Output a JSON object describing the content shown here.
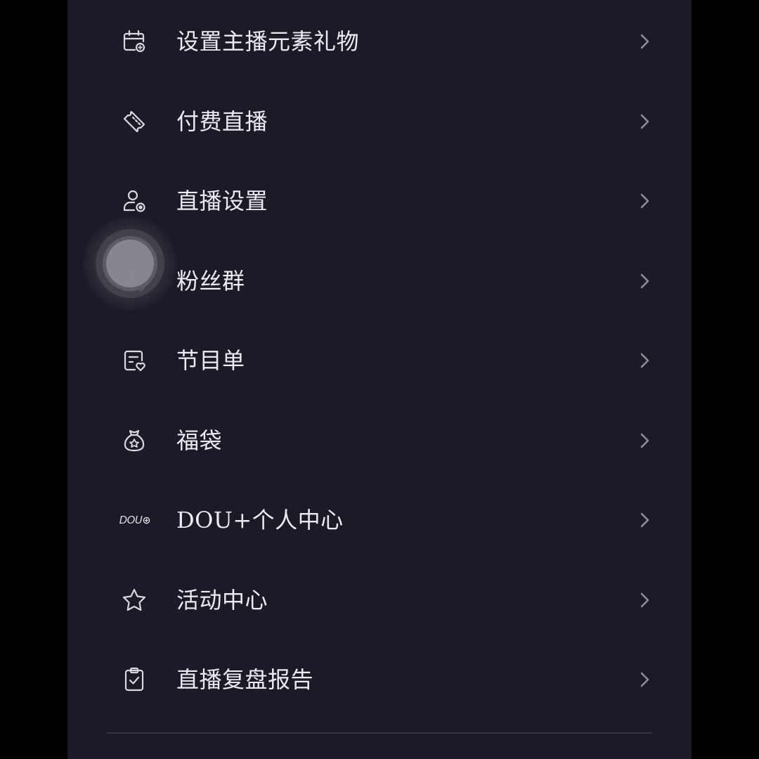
{
  "theme": {
    "background": "#000000",
    "panel": "#1b1a26",
    "text": "#ecebf1",
    "icon": "#d9d8de",
    "chevron": "#8e8d96",
    "divider": "#34333f"
  },
  "menu": {
    "items": [
      {
        "label": "设置主播元素礼物",
        "icon": "gift-calendar-icon"
      },
      {
        "label": "付费直播",
        "icon": "ticket-icon"
      },
      {
        "label": "直播设置",
        "icon": "user-settings-icon"
      },
      {
        "label": "粉丝群",
        "icon": "user-heart-icon"
      },
      {
        "label": "节目单",
        "icon": "program-list-icon"
      },
      {
        "label": "福袋",
        "icon": "lucky-bag-icon"
      },
      {
        "label": "DOU+个人中心",
        "icon": "dou-plus-icon",
        "icon_text": "DOU"
      },
      {
        "label": "活动中心",
        "icon": "star-icon"
      },
      {
        "label": "直播复盘报告",
        "icon": "clipboard-check-icon"
      }
    ]
  }
}
